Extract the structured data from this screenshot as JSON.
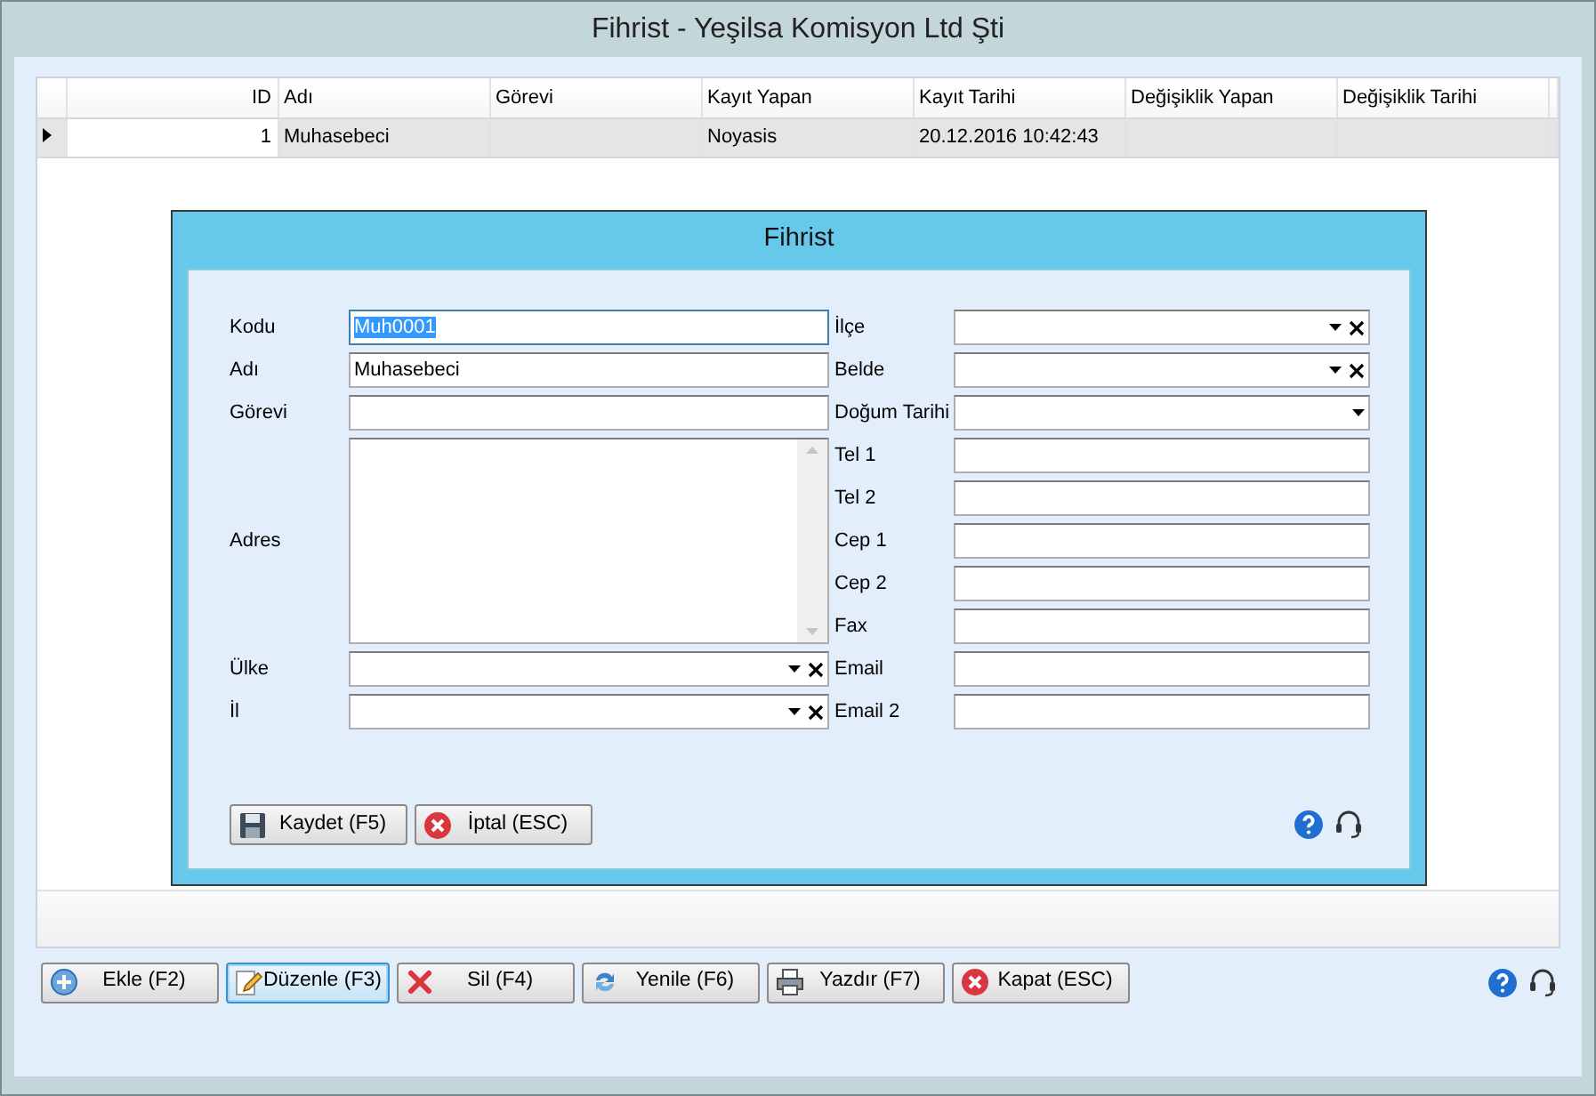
{
  "window": {
    "title": "Fihrist - Yeşilsa Komisyon Ltd Şti"
  },
  "grid": {
    "columns": [
      {
        "label": "ID"
      },
      {
        "label": "Adı"
      },
      {
        "label": "Görevi"
      },
      {
        "label": "Kayıt Yapan"
      },
      {
        "label": "Kayıt Tarihi"
      },
      {
        "label": "Değişiklik Yapan"
      },
      {
        "label": "Değişiklik Tarihi"
      }
    ],
    "rows": [
      {
        "selected": true,
        "cells": [
          "1",
          "Muhasebeci",
          "",
          "Noyasis",
          "20.12.2016 10:42:43",
          "",
          ""
        ]
      }
    ]
  },
  "dialog": {
    "title": "Fihrist",
    "left_fields": [
      {
        "label": "Kodu",
        "kind": "text",
        "value": "Muh0001",
        "focused": true
      },
      {
        "label": "Adı",
        "kind": "text",
        "value": "Muhasebeci",
        "focused": false
      },
      {
        "label": "Görevi",
        "kind": "text",
        "focused": false
      },
      {
        "label": "Adres",
        "kind": "memo",
        "focused": false
      },
      {
        "label": "Ülke",
        "kind": "combo",
        "focused": false
      },
      {
        "label": "İl",
        "kind": "combo",
        "focused": false
      }
    ],
    "right_fields": [
      {
        "label": "İlçe",
        "kind": "combo"
      },
      {
        "label": "Belde",
        "kind": "combo"
      },
      {
        "label": "Doğum Tarihi",
        "kind": "date"
      },
      {
        "label": "Tel 1",
        "kind": "text"
      },
      {
        "label": "Tel 2",
        "kind": "text"
      },
      {
        "label": "Cep 1",
        "kind": "text"
      },
      {
        "label": "Cep 2",
        "kind": "text"
      },
      {
        "label": "Fax",
        "kind": "text"
      },
      {
        "label": "Email",
        "kind": "text"
      },
      {
        "label": "Email 2",
        "kind": "text"
      }
    ],
    "buttons": [
      {
        "label": "Kaydet (F5)",
        "kind": "save",
        "focused": false
      },
      {
        "label": "İptal (ESC)",
        "kind": "cancel",
        "focused": false
      }
    ]
  },
  "toolbar": [
    {
      "label": "Ekle (F2)",
      "kind": "add",
      "focused": false
    },
    {
      "label": "Düzenle (F3)",
      "kind": "edit",
      "focused": true
    },
    {
      "label": "Sil (F4)",
      "kind": "delete",
      "focused": false
    },
    {
      "label": "Yenile (F6)",
      "kind": "refresh",
      "focused": false
    },
    {
      "label": "Yazdır (F7)",
      "kind": "print",
      "focused": false
    },
    {
      "label": "Kapat (ESC)",
      "kind": "close",
      "focused": false
    }
  ]
}
